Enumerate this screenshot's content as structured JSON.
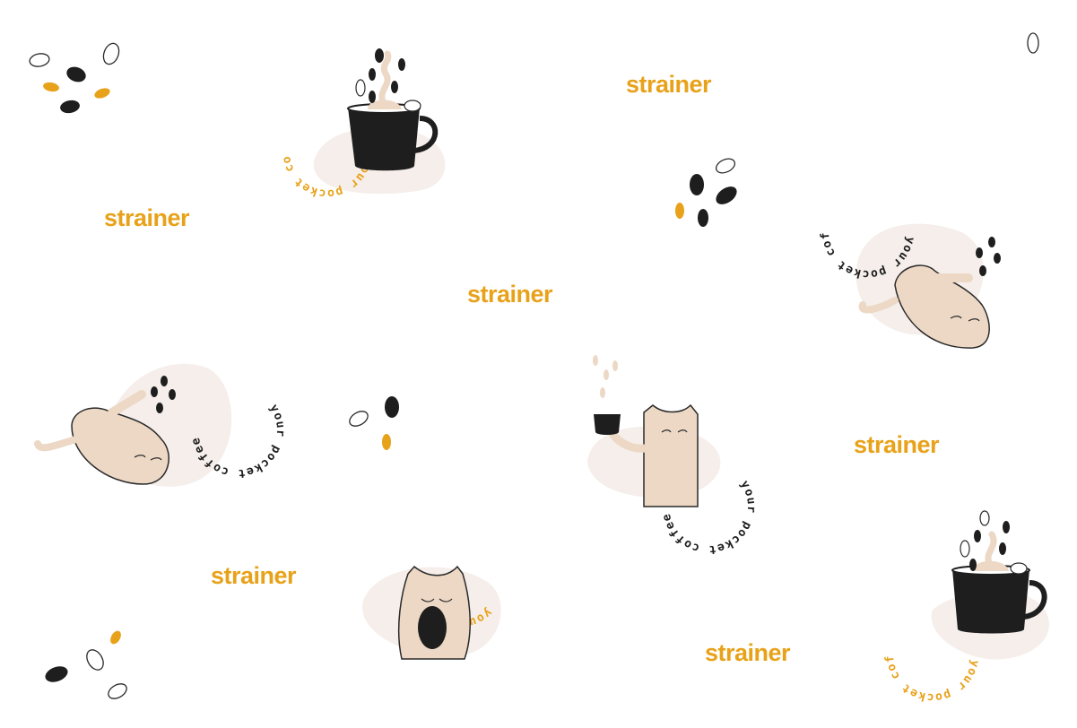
{
  "brand": {
    "wordmark": "strainer",
    "slogan": "your pocket coffee"
  },
  "colors": {
    "orange": "#e8a21a",
    "dark": "#1e1e1e",
    "beige": "#ecd8c5",
    "blob": "#f5eeea",
    "outline": "#2a2a2a"
  },
  "icons": [
    "coffee-bean-icon",
    "coffee-cup-icon",
    "cat-icon"
  ]
}
